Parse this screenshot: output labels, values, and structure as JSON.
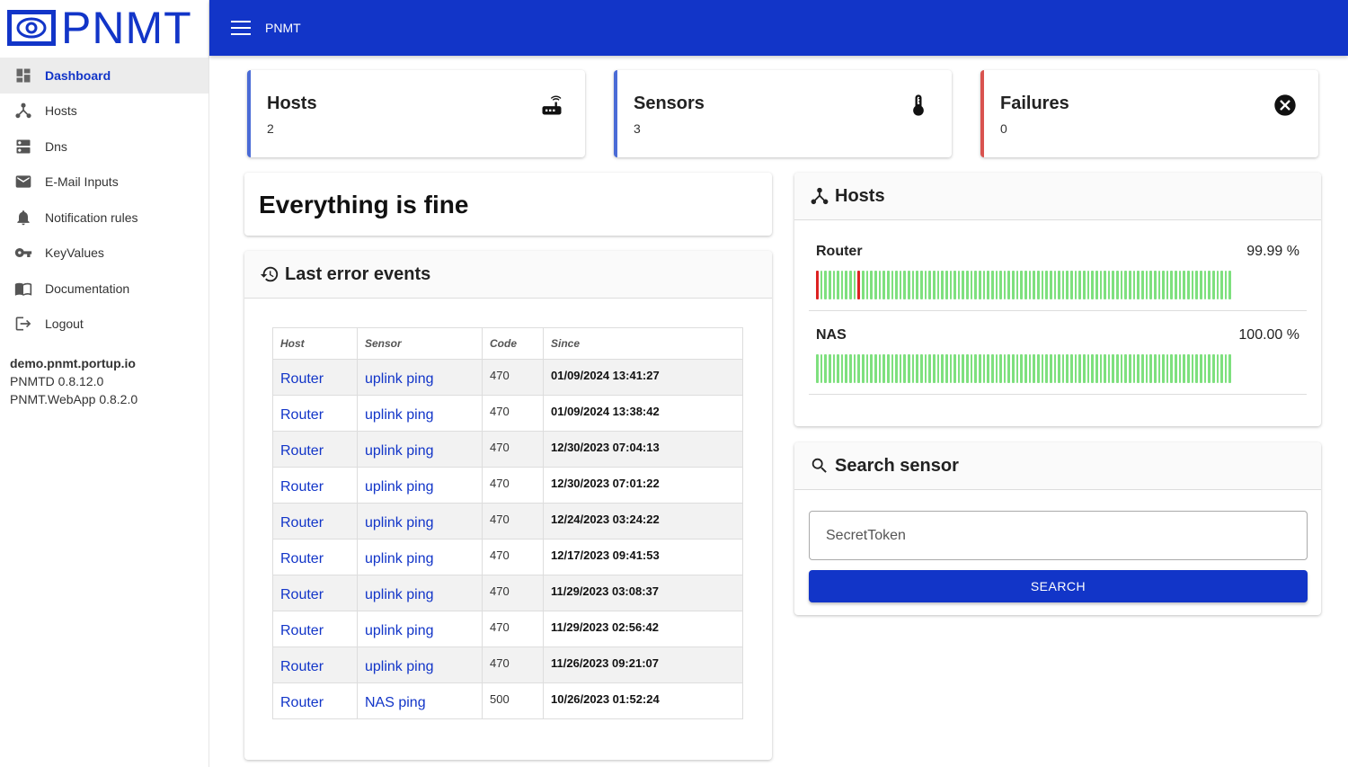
{
  "app": {
    "logo_text": "PNMT",
    "title": "PNMT"
  },
  "sidebar": {
    "items": [
      {
        "label": "Dashboard",
        "icon": "dashboard-icon",
        "active": true
      },
      {
        "label": "Hosts",
        "icon": "hub-icon"
      },
      {
        "label": "Dns",
        "icon": "dns-icon"
      },
      {
        "label": "E-Mail Inputs",
        "icon": "mail-icon"
      },
      {
        "label": "Notification rules",
        "icon": "bell-icon"
      },
      {
        "label": "KeyValues",
        "icon": "key-icon"
      },
      {
        "label": "Documentation",
        "icon": "book-icon"
      },
      {
        "label": "Logout",
        "icon": "logout-icon"
      }
    ],
    "info": {
      "host": "demo.pnmt.portup.io",
      "pnmtd": "PNMTD 0.8.12.0",
      "webapp": "PNMT.WebApp 0.8.2.0"
    }
  },
  "stats": {
    "hosts": {
      "title": "Hosts",
      "count": "2",
      "icon": "router-icon"
    },
    "sensors": {
      "title": "Sensors",
      "count": "3",
      "icon": "thermometer-icon"
    },
    "failures": {
      "title": "Failures",
      "count": "0",
      "icon": "close-circle-icon"
    }
  },
  "status": {
    "message": "Everything is fine"
  },
  "errors": {
    "title": "Last error events",
    "columns": [
      "Host",
      "Sensor",
      "Code",
      "Since"
    ],
    "rows": [
      [
        "Router",
        "uplink ping",
        "470",
        "01/09/2024 13:41:27"
      ],
      [
        "Router",
        "uplink ping",
        "470",
        "01/09/2024 13:38:42"
      ],
      [
        "Router",
        "uplink ping",
        "470",
        "12/30/2023 07:04:13"
      ],
      [
        "Router",
        "uplink ping",
        "470",
        "12/30/2023 07:01:22"
      ],
      [
        "Router",
        "uplink ping",
        "470",
        "12/24/2023 03:24:22"
      ],
      [
        "Router",
        "uplink ping",
        "470",
        "12/17/2023 09:41:53"
      ],
      [
        "Router",
        "uplink ping",
        "470",
        "11/29/2023 03:08:37"
      ],
      [
        "Router",
        "uplink ping",
        "470",
        "11/29/2023 02:56:42"
      ],
      [
        "Router",
        "uplink ping",
        "470",
        "11/26/2023 09:21:07"
      ],
      [
        "Router",
        "NAS ping",
        "500",
        "10/26/2023 01:52:24"
      ]
    ]
  },
  "hosts_panel": {
    "title": "Hosts",
    "hosts": [
      {
        "name": "Router",
        "uptime": "99.99 %",
        "bar_count": 100,
        "bad_indices": [
          0,
          10
        ]
      },
      {
        "name": "NAS",
        "uptime": "100.00 %",
        "bar_count": 100,
        "bad_indices": []
      }
    ]
  },
  "search": {
    "title": "Search sensor",
    "value": "SecretToken",
    "button": "SEARCH"
  },
  "colors": {
    "primary": "#1235c8",
    "ok": "#7ee07e",
    "bad": "#dd2222",
    "failure_border": "#d9534f"
  }
}
